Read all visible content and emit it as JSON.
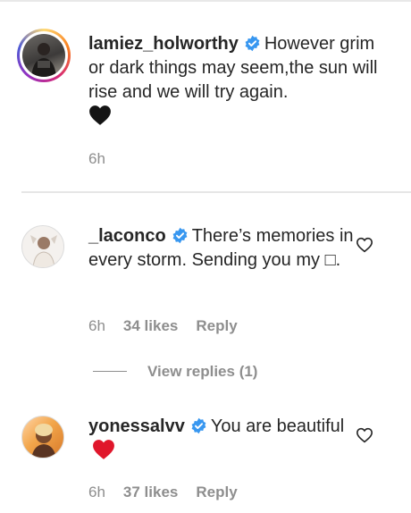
{
  "comments": [
    {
      "username": "lamiez_holworthy",
      "verified": true,
      "text": "However grim or dark things may seem,the sun will rise and we will try again.",
      "emoji": "black-heart",
      "time": "6h",
      "has_story_ring": true
    },
    {
      "username": "_laconco",
      "verified": true,
      "text": "There’s memories in every storm. Sending you my ",
      "text_end": "□.",
      "time": "6h",
      "likes": "34 likes",
      "reply": "Reply",
      "view_replies": "View replies (1)"
    },
    {
      "username": "yonessalvv",
      "verified": true,
      "text": "You are beautiful",
      "emoji": "red-heart",
      "time": "6h",
      "likes": "37 likes",
      "reply": "Reply"
    }
  ],
  "colors": {
    "verified": "#3897f0",
    "muted": "#8e8e8e",
    "red_heart": "#e0162b"
  }
}
